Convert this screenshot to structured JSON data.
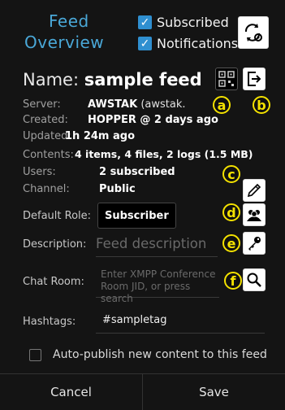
{
  "header": {
    "title_line1": "Feed",
    "title_line2": "Overview",
    "subscribed": {
      "label": "Subscribed",
      "checked": true
    },
    "notifications": {
      "label": "Notifications",
      "checked": true
    },
    "sync_icon": "refresh-gear-icon"
  },
  "name": {
    "label": "Name:",
    "value": "sample feed"
  },
  "info": [
    {
      "label": "Server:",
      "value": "AWSTAK",
      "extra": " (awstak."
    },
    {
      "label": "Created:",
      "value": "HOPPER @ 2 days ago",
      "extra": ""
    },
    {
      "label": "Updated:",
      "value": "1h 24m ago",
      "extra": ""
    },
    {
      "label": "Contents:",
      "value": "4 items, 4 files, 2 logs (1.5 MB)",
      "extra": ""
    },
    {
      "label": "Users:",
      "value": "2 subscribed",
      "extra": ""
    },
    {
      "label": "Channel:",
      "value": "Public",
      "extra": ""
    }
  ],
  "default_role": {
    "label": "Default Role:",
    "value": "Subscriber"
  },
  "description": {
    "label": "Description:",
    "placeholder": "Feed description"
  },
  "chat_room": {
    "label": "Chat Room:",
    "placeholder": "Enter XMPP Conference Room JID, or press search"
  },
  "hashtags": {
    "label": "Hashtags:",
    "value": "#sampletag"
  },
  "autopublish": {
    "label": "Auto-publish new content to this feed",
    "checked": false
  },
  "callouts": {
    "a": "a",
    "b": "b",
    "c": "c",
    "d": "d",
    "e": "e",
    "f": "f"
  },
  "buttons": {
    "cancel": "Cancel",
    "save": "Save"
  },
  "colors": {
    "accent": "#2f8fd0",
    "callout": "#f3e100",
    "background": "#141414"
  }
}
